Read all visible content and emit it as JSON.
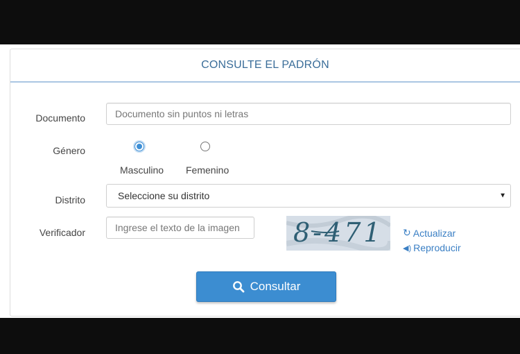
{
  "panel": {
    "title": "CONSULTE EL PADRÓN"
  },
  "form": {
    "documento": {
      "label": "Documento",
      "placeholder": "Documento sin puntos ni letras",
      "value": ""
    },
    "genero": {
      "label": "Género",
      "options": [
        {
          "label": "Masculino",
          "selected": true
        },
        {
          "label": "Femenino",
          "selected": false
        }
      ]
    },
    "distrito": {
      "label": "Distrito",
      "selected": "Seleccione su distrito"
    },
    "verificador": {
      "label": "Verificador",
      "placeholder": "Ingrese el texto de la imagen",
      "value": "",
      "captcha_text": "8-471",
      "actualizar_label": "Actualizar",
      "reproducir_label": "Reproducir"
    },
    "submit_label": "Consultar"
  },
  "colors": {
    "accent": "#3c8dd1",
    "heading_text": "#3a6d99",
    "link": "#3a7fc4",
    "captcha_bg": "#d4dde6",
    "captcha_text": "#2f5f74"
  },
  "icons": {
    "submit": "search-icon",
    "actualizar": "refresh-icon",
    "reproducir": "volume-icon",
    "select": "caret-down-icon"
  }
}
